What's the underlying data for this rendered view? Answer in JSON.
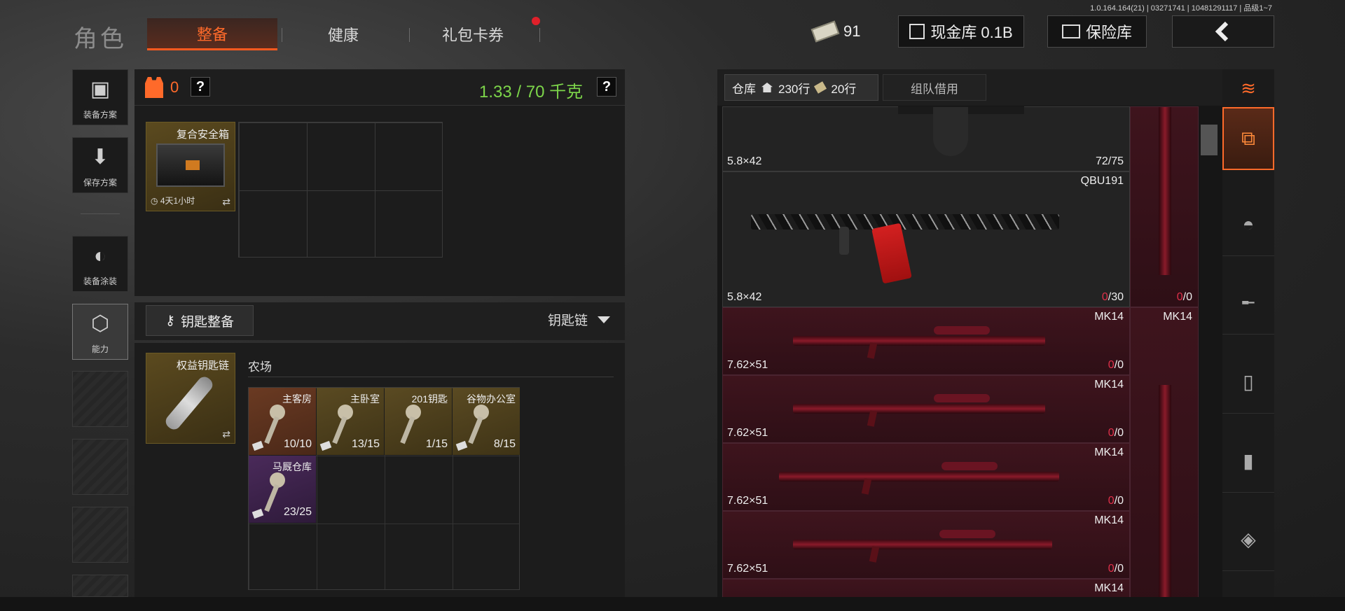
{
  "version": "1.0.164.164(21) | 03271741 | 10481291117 | 品级1~7",
  "header": {
    "title": "角色",
    "tabs": [
      "整备",
      "健康",
      "礼包卡券"
    ],
    "money": "91",
    "cash_label": "现金库 0.1B",
    "safe_label": "保险库"
  },
  "sidebar": {
    "items": [
      {
        "label": "装备方案",
        "icon": "vest-icon"
      },
      {
        "label": "保存方案",
        "icon": "download-icon"
      },
      {
        "label": "装备涂装",
        "icon": "helmet-paint-icon"
      },
      {
        "label": "能力",
        "icon": "lightning-hex-icon"
      }
    ]
  },
  "container": {
    "armor_count": "0",
    "help": "?",
    "weight": "1.33 / 70 千克",
    "safebox": {
      "name": "复合安全箱",
      "time": "4天1小时"
    }
  },
  "keys": {
    "equip_label": "钥匙整备",
    "keychain_select": "钥匙链",
    "keychain_name": "权益钥匙链",
    "location": "农场",
    "items": [
      {
        "name": "主客房",
        "count": "10/10"
      },
      {
        "name": "主卧室",
        "count": "13/15"
      },
      {
        "name": "201钥匙",
        "count": "1/15"
      },
      {
        "name": "谷物办公室",
        "count": "8/15"
      },
      {
        "name": "马厩仓库",
        "count": "23/25"
      }
    ]
  },
  "warehouse": {
    "tab_label": "仓库",
    "rows_a": "230行",
    "rows_b": "20行",
    "borrow_tab": "组队借用",
    "items": [
      {
        "name": "",
        "caliber": "5.8×42",
        "ammo": "72/75"
      },
      {
        "name": "QBU191",
        "caliber": "5.8×42",
        "ammo_zero": "0",
        "ammo_rest": "/30"
      },
      {
        "name": "MK14",
        "caliber": "7.62×51",
        "ammo_zero": "0",
        "ammo_rest": "/0"
      },
      {
        "name": "MK14",
        "caliber": "7.62×51",
        "ammo_zero": "0",
        "ammo_rest": "/0"
      },
      {
        "name": "MK14",
        "caliber": "7.62×51",
        "ammo_zero": "0",
        "ammo_rest": "/0"
      },
      {
        "name": "MK14",
        "caliber": "7.62×51",
        "ammo_zero": "0",
        "ammo_rest": "/0"
      },
      {
        "name": "MK14",
        "caliber": "",
        "ammo": ""
      }
    ],
    "side": [
      {
        "name": "",
        "ammo_zero": "0",
        "ammo_rest": "/0"
      },
      {
        "name": "MK14"
      }
    ]
  },
  "rail": {
    "icons": [
      "sort-refresh-icon",
      "all-items-icon",
      "helmet-icon",
      "rifle-icon",
      "magazine-icon",
      "ammo-icon",
      "attachment-icon"
    ]
  },
  "colors": {
    "accent": "#ff6a2a",
    "weight_green": "#7dd64a",
    "warning_red": "#e0304a"
  }
}
